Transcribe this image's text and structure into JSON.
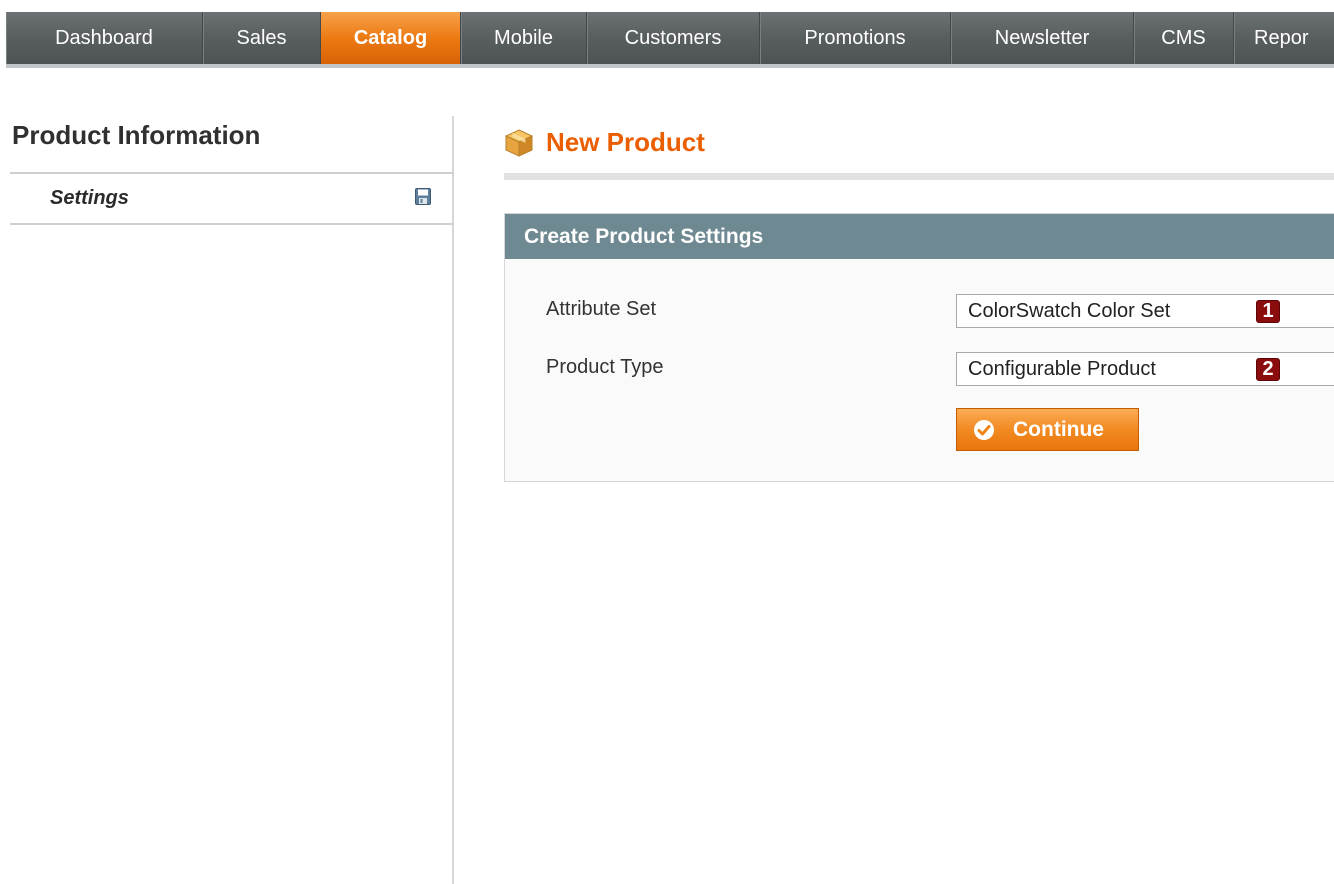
{
  "nav": {
    "items": [
      {
        "label": "Dashboard",
        "active": false
      },
      {
        "label": "Sales",
        "active": false
      },
      {
        "label": "Catalog",
        "active": true
      },
      {
        "label": "Mobile",
        "active": false
      },
      {
        "label": "Customers",
        "active": false
      },
      {
        "label": "Promotions",
        "active": false
      },
      {
        "label": "Newsletter",
        "active": false
      },
      {
        "label": "CMS",
        "active": false
      },
      {
        "label": "Repor",
        "active": false
      }
    ]
  },
  "sidebar": {
    "title": "Product Information",
    "tab_label": "Settings",
    "tab_icon": "save-icon"
  },
  "page": {
    "title": "New Product",
    "title_icon": "box-icon"
  },
  "settings": {
    "heading": "Create Product Settings",
    "fields": [
      {
        "label": "Attribute Set",
        "value": "ColorSwatch Color Set",
        "marker": "1"
      },
      {
        "label": "Product Type",
        "value": "Configurable Product",
        "marker": "2"
      }
    ],
    "continue_label": "Continue"
  },
  "colors": {
    "nav_active": "#ec7a13",
    "title": "#eb5e00",
    "fieldset_header": "#6f8992",
    "marker": "#8b0c0c",
    "button": "#f28a22"
  }
}
